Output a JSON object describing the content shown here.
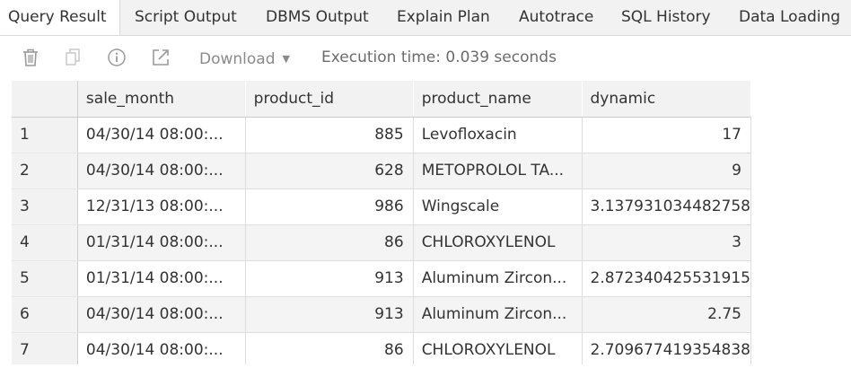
{
  "tabs": [
    {
      "label": "Query Result",
      "active": true
    },
    {
      "label": "Script Output"
    },
    {
      "label": "DBMS Output"
    },
    {
      "label": "Explain Plan"
    },
    {
      "label": "Autotrace"
    },
    {
      "label": "SQL History"
    },
    {
      "label": "Data Loading"
    }
  ],
  "toolbar": {
    "delete_icon": "trash-icon",
    "copy_icon": "copy-icon",
    "info_icon": "info-icon",
    "open_icon": "external-open-icon",
    "download_label": "Download",
    "execution_time": "Execution time: 0.039 seconds"
  },
  "grid": {
    "columns": [
      "sale_month",
      "product_id",
      "product_name",
      "dynamic"
    ],
    "rows": [
      {
        "n": "1",
        "sale_month": "04/30/14 08:00:...",
        "product_id": "885",
        "product_name": "Levofloxacin",
        "dynamic": "17"
      },
      {
        "n": "2",
        "sale_month": "04/30/14 08:00:...",
        "product_id": "628",
        "product_name": "METOPROLOL TA...",
        "dynamic": "9"
      },
      {
        "n": "3",
        "sale_month": "12/31/13 08:00:...",
        "product_id": "986",
        "product_name": "Wingscale",
        "dynamic": "3.137931034482758"
      },
      {
        "n": "4",
        "sale_month": "01/31/14 08:00:...",
        "product_id": "86",
        "product_name": "CHLOROXYLENOL",
        "dynamic": "3"
      },
      {
        "n": "5",
        "sale_month": "01/31/14 08:00:...",
        "product_id": "913",
        "product_name": "Aluminum Zircon...",
        "dynamic": "2.872340425531915"
      },
      {
        "n": "6",
        "sale_month": "04/30/14 08:00:...",
        "product_id": "913",
        "product_name": "Aluminum Zircon...",
        "dynamic": "2.75"
      },
      {
        "n": "7",
        "sale_month": "04/30/14 08:00:...",
        "product_id": "86",
        "product_name": "CHLOROXYLENOL",
        "dynamic": "2.709677419354838"
      }
    ]
  }
}
